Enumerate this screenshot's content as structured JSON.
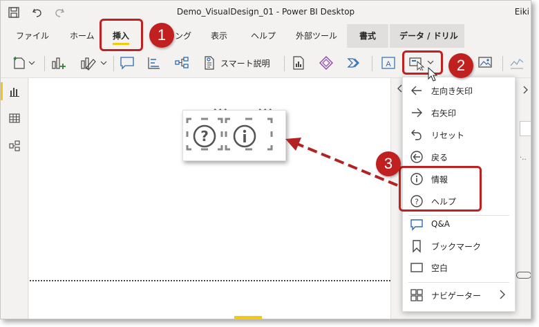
{
  "window": {
    "title": "Demo_VisualDesign_01 - Power BI Desktop",
    "user": "Eiki"
  },
  "tabs": [
    {
      "label": "ファイル"
    },
    {
      "label": "ホーム"
    },
    {
      "label": "挿入"
    },
    {
      "label": "ング"
    },
    {
      "label": "表示"
    },
    {
      "label": "ヘルプ"
    },
    {
      "label": "外部ツール"
    },
    {
      "label": "書式"
    },
    {
      "label": "データ / ドリル"
    }
  ],
  "active_tab": "挿入",
  "toolbar": {
    "smart_narrative_label": "スマート説明"
  },
  "menu": {
    "items": [
      {
        "label": "左向き矢印",
        "icon": "arrow-left-icon"
      },
      {
        "label": "右矢印",
        "icon": "arrow-right-icon"
      },
      {
        "label": "リセット",
        "icon": "reset-icon"
      },
      {
        "label": "戻る",
        "icon": "back-circle-icon"
      },
      {
        "label": "情報",
        "icon": "info-icon"
      },
      {
        "label": "ヘルプ",
        "icon": "help-icon"
      },
      {
        "label": "Q&A",
        "icon": "qna-icon"
      },
      {
        "label": "ブックマーク",
        "icon": "bookmark-icon"
      },
      {
        "label": "空白",
        "icon": "blank-icon"
      },
      {
        "label": "ナビゲーター",
        "icon": "navigator-icon"
      }
    ]
  },
  "annotations": {
    "badge1": "1",
    "badge2": "2",
    "badge3": "3"
  },
  "colors": {
    "accent_yellow": "#f2c811",
    "annotation_red": "#c0201f",
    "arrow_red": "#b22222"
  }
}
